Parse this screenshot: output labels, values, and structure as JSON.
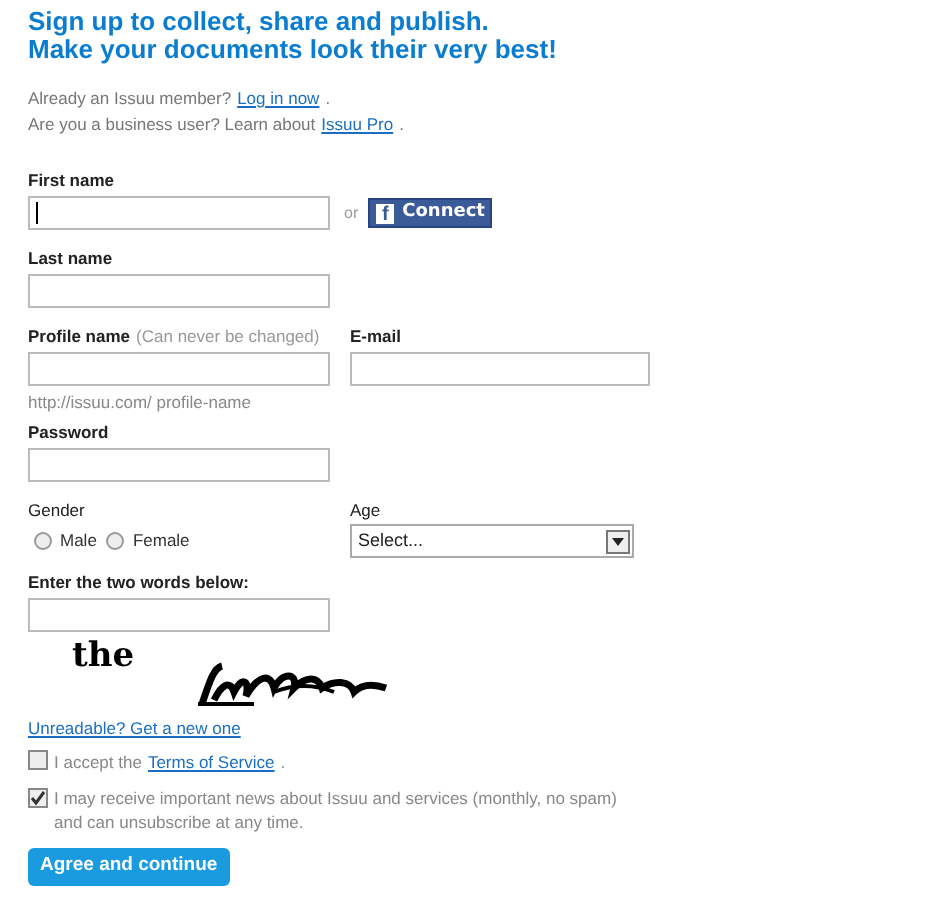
{
  "heading": [
    "Sign up to collect, share and publish.",
    "Make your documents look their very best!"
  ],
  "intro": [
    {
      "text": "Already an Issuu member?",
      "link": "Log in now",
      "suffix": "."
    },
    {
      "text": "Are you a business user? Learn about",
      "link": "Issuu Pro",
      "suffix": "."
    }
  ],
  "first_name": {
    "label": "First name",
    "focused": true
  },
  "or": "or",
  "facebook_button": {
    "icon": "f",
    "label": "Connect"
  },
  "last_name": {
    "label": "Last name",
    "focused": false
  },
  "profile_name": {
    "label": "Profile name",
    "note": "(Can never be changed)",
    "hint": "http://issuu.com/ profile-name",
    "focused": false
  },
  "email": {
    "label": "E-mail",
    "focused": false
  },
  "password": {
    "label": "Password",
    "focused": false
  },
  "gender": {
    "label": "Gender",
    "options": [
      {
        "label": "Male",
        "selected": false
      },
      {
        "label": "Female",
        "selected": false
      }
    ]
  },
  "age": {
    "label": "Age",
    "value": "Select..."
  },
  "captcha": {
    "label": "Enter the two words below:",
    "first_word": "the",
    "focused": false
  },
  "captcha_refresh": "Unreadable? Get a new one",
  "checkboxes": [
    {
      "text": "I accept the",
      "link": "Terms of Service",
      "suffix": ".",
      "checked": false
    },
    {
      "text": "I may receive important news about Issuu and services (monthly, no spam) and can unsubscribe at any time.",
      "checked": true
    }
  ],
  "submit_button": "Agree and continue"
}
